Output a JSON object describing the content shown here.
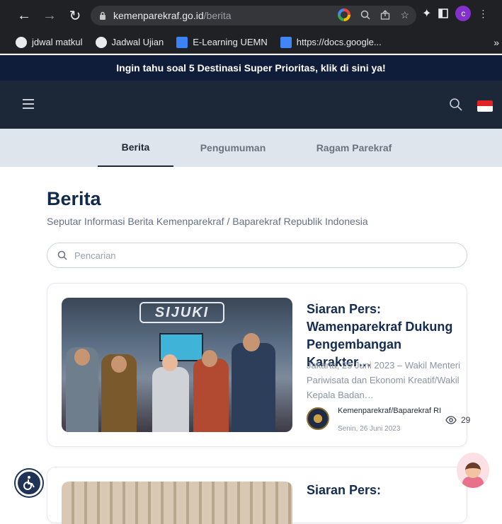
{
  "browser": {
    "domain": "kemenparekraf.go.id",
    "path": "/berita",
    "profile_initial": "c",
    "bookmarks": [
      {
        "label": "jdwal matkul",
        "icon": "globe-icon"
      },
      {
        "label": "Jadwal Ujian",
        "icon": "globe-icon"
      },
      {
        "label": "E-Learning UEMN",
        "icon": "elearning-icon"
      },
      {
        "label": "https://docs.google...",
        "icon": "google-docs-icon"
      }
    ],
    "bookmarks_more": "»"
  },
  "site": {
    "promo_banner": "Ingin tahu soal 5 Destinasi Super Prioritas, klik di sini ya!",
    "tabs": [
      {
        "label": "Berita",
        "active": true
      },
      {
        "label": "Pengumuman",
        "active": false
      },
      {
        "label": "Ragam Parekraf",
        "active": false
      }
    ],
    "page_title": "Berita",
    "page_subtitle": "Seputar Informasi Berita Kemenparekraf / Baparekraf Republik Indonesia",
    "search_placeholder": "Pencarian",
    "image_sign_text": "SIJUKI",
    "articles": [
      {
        "title": "Siaran Pers: Wamenparekraf Dukung Pengembangan Karakter…",
        "excerpt": "Jakarta, 25 Juni 2023 – Wakil Menteri Pariwisata dan Ekonomi Kreatif/Wakil Kepala Badan…",
        "author": "Kemenparekraf/Baparekraf RI",
        "date": "Senin, 26 Juni 2023",
        "views": "29"
      },
      {
        "title": "Siaran Pers:"
      }
    ]
  },
  "colors": {
    "header_bg": "#1c2838",
    "promo_bg": "#0f1c3a",
    "tabs_bg": "#dfe5ec",
    "title_color": "#102a4c",
    "accent_flag_red": "#e02424"
  }
}
